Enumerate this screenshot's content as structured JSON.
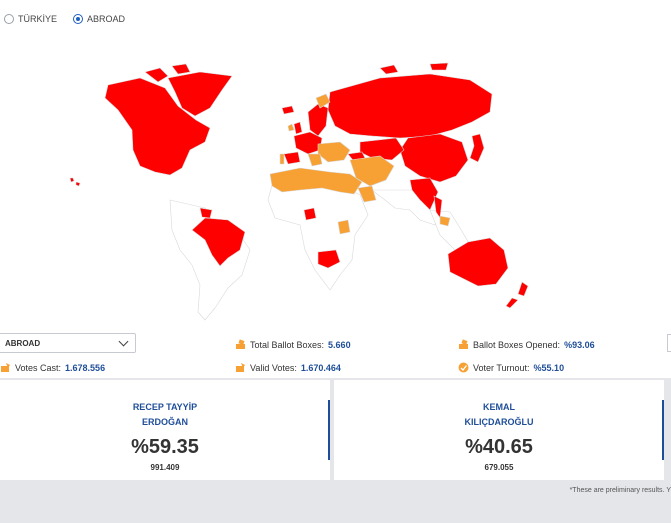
{
  "region_toggle": {
    "options": [
      "TÜRKİYE",
      "ABROAD"
    ],
    "selected": "ABROAD"
  },
  "map": {
    "colors": {
      "leading_erdogan": "#fe0000",
      "leading_kilicdaroglu": "#f7a135",
      "no_data": "#ffffff",
      "border": "#d9d9d9"
    }
  },
  "filter": {
    "selected": "ABROAD"
  },
  "stats": {
    "total_ballot_boxes_label": "Total Ballot Boxes:",
    "total_ballot_boxes_value": "5.660",
    "ballot_boxes_opened_label": "Ballot Boxes Opened:",
    "ballot_boxes_opened_value": "%93.06",
    "votes_cast_label": "Votes Cast:",
    "votes_cast_value": "1.678.556",
    "valid_votes_label": "Valid Votes:",
    "valid_votes_value": "1.670.464",
    "voter_turnout_label": "Voter Turnout:",
    "voter_turnout_value": "%55.10"
  },
  "candidates": [
    {
      "name_line1": "RECEP TAYYİP",
      "name_line2": "ERDOĞAN",
      "percent": "%59.35",
      "votes": "991.409"
    },
    {
      "name_line1": "KEMAL",
      "name_line2": "KILIÇDAROĞLU",
      "percent": "%40.65",
      "votes": "679.055"
    }
  ],
  "footnote": "*These are preliminary results. Y"
}
